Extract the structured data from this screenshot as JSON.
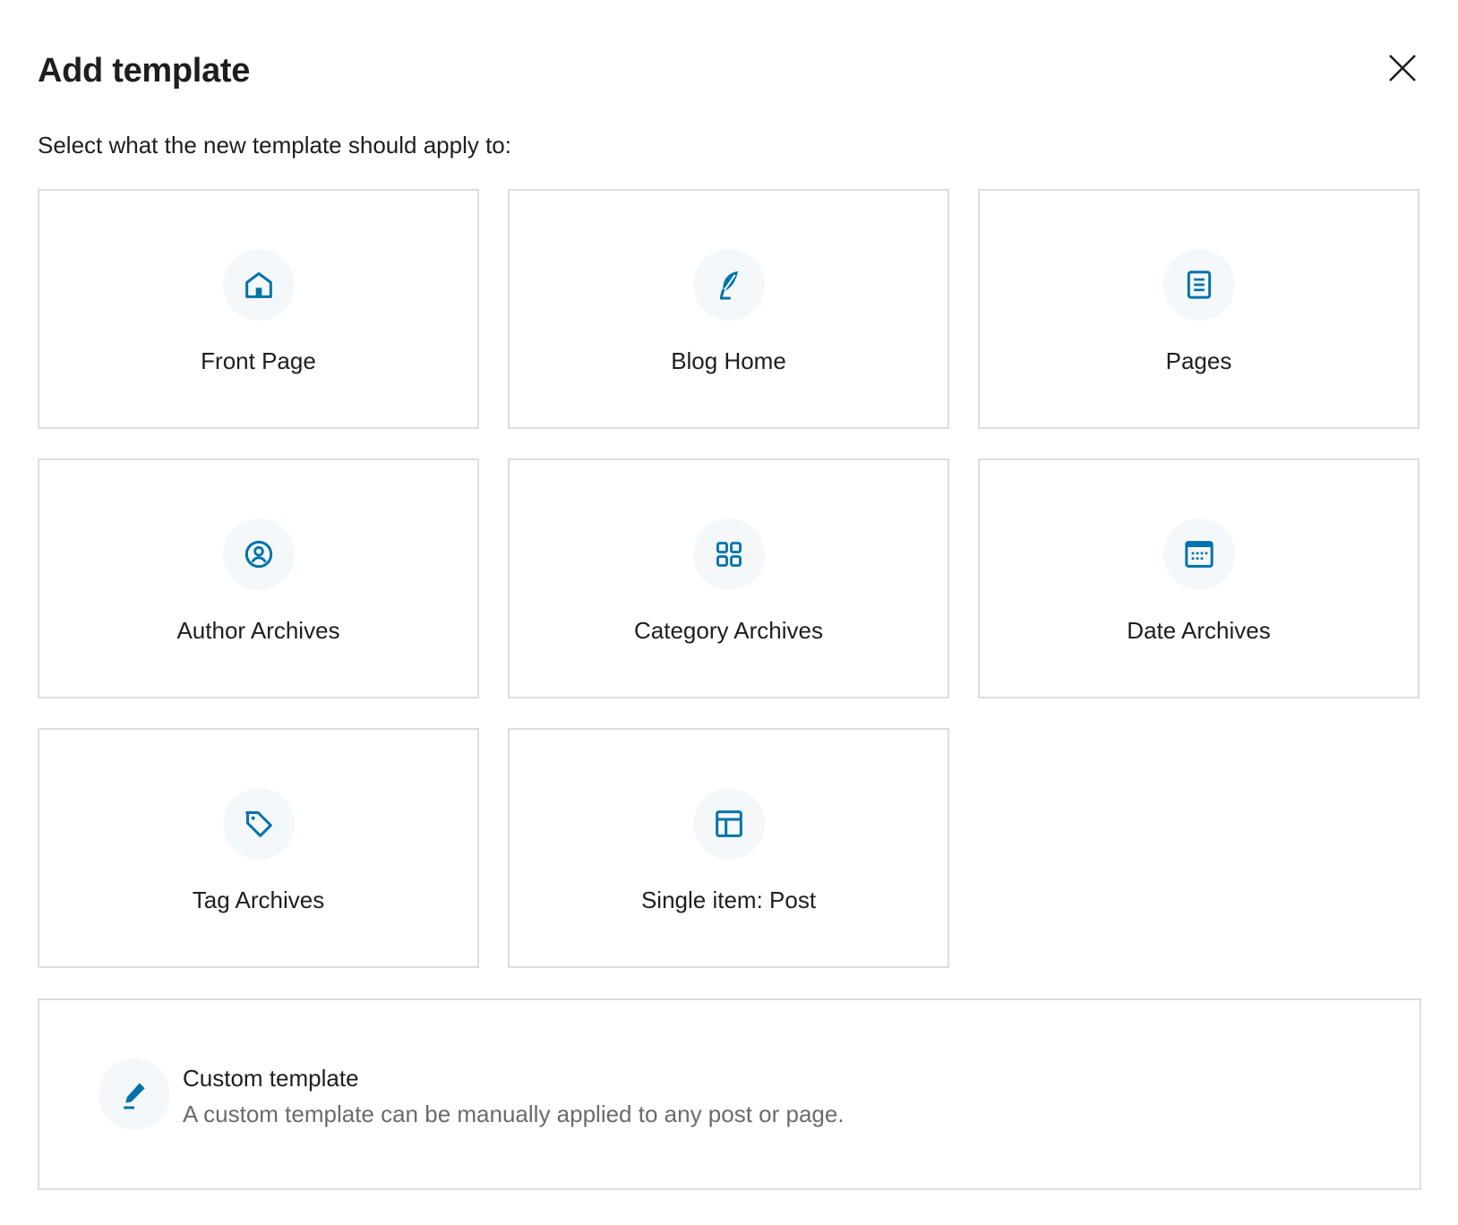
{
  "modal": {
    "title": "Add template",
    "subtitle": "Select what the new template should apply to:",
    "close_icon": "close-icon"
  },
  "accent_color": "#0073aa",
  "templates": [
    {
      "label": "Front Page",
      "icon": "home-icon"
    },
    {
      "label": "Blog Home",
      "icon": "feather-icon"
    },
    {
      "label": "Pages",
      "icon": "page-icon"
    },
    {
      "label": "Author Archives",
      "icon": "author-icon"
    },
    {
      "label": "Category Archives",
      "icon": "category-icon"
    },
    {
      "label": "Date Archives",
      "icon": "calendar-icon"
    },
    {
      "label": "Tag Archives",
      "icon": "tag-icon"
    },
    {
      "label": "Single item: Post",
      "icon": "layout-icon"
    }
  ],
  "custom": {
    "title": "Custom template",
    "description": "A custom template can be manually applied to any post or page.",
    "icon": "pencil-icon"
  }
}
